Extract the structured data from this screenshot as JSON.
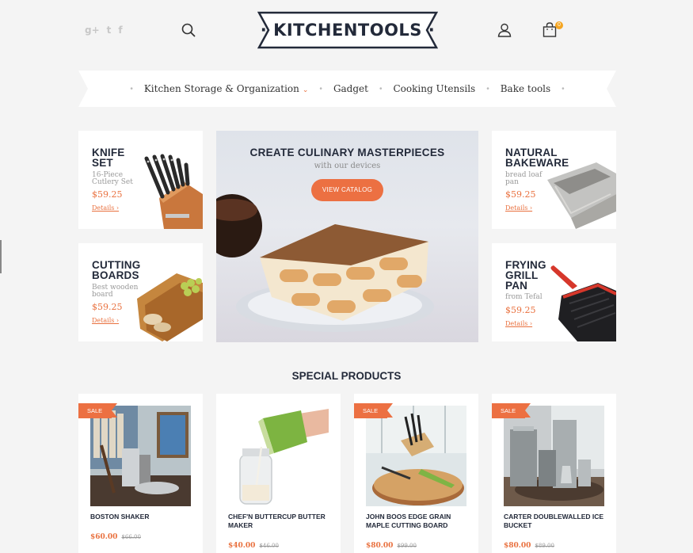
{
  "header": {
    "social": [
      "g+",
      "t",
      "f"
    ],
    "logo_text": "· KITCHENTOOLS ·",
    "cart_count": "0"
  },
  "nav": {
    "items": [
      {
        "label": "Kitchen Storage & Organization",
        "has_dropdown": true
      },
      {
        "label": "Gadget",
        "has_dropdown": false
      },
      {
        "label": "Cooking Utensils",
        "has_dropdown": false
      },
      {
        "label": "Bake tools",
        "has_dropdown": false
      }
    ]
  },
  "promos": {
    "knife": {
      "title_1": "KNIFE",
      "title_2": "SET",
      "sub_1": "16-Piece",
      "sub_2": "Cutlery Set",
      "price": "$59.25",
      "link": "Details ›"
    },
    "boards": {
      "title_1": "CUTTING",
      "title_2": "BOARDS",
      "sub_1": "Best wooden",
      "sub_2": "board",
      "price": "$59.25",
      "link": "Details ›"
    },
    "bakeware": {
      "title_1": "NATURAL",
      "title_2": "BAKEWARE",
      "sub_1": "bread loaf",
      "sub_2": "pan",
      "price": "$59.25",
      "link": "Details ›"
    },
    "pan": {
      "title_1": "FRYING",
      "title_2": "GRILL",
      "title_3": "PAN",
      "sub_1": "from Tefal",
      "price": "$59.25",
      "link": "Details ›"
    }
  },
  "hero": {
    "title": "CREATE CULINARY MASTERPIECES",
    "subtitle": "with our devices",
    "button": "VIEW CATALOG"
  },
  "special": {
    "title": "SPECIAL PRODUCTS",
    "sale_label": "SALE",
    "products": [
      {
        "name": "BOSTON SHAKER",
        "price": "$60.00",
        "old_price": "$66.00",
        "sale": true
      },
      {
        "name": "CHEF'N BUTTERCUP BUTTER MAKER",
        "price": "$40.00",
        "old_price": "$46.00",
        "sale": false
      },
      {
        "name": "JOHN BOOS EDGE GRAIN MAPLE CUTTING BOARD",
        "price": "$80.00",
        "old_price": "$99.00",
        "sale": true
      },
      {
        "name": "CARTER DOUBLEWALLED ICE BUCKET",
        "price": "$80.00",
        "old_price": "$89.00",
        "sale": true
      }
    ]
  },
  "colors": {
    "accent": "#ec7042",
    "dark": "#232a3a",
    "badge": "#f5a623"
  },
  "icons": [
    "google-plus-icon",
    "twitter-icon",
    "facebook-icon",
    "search-icon",
    "user-icon",
    "cart-icon"
  ]
}
